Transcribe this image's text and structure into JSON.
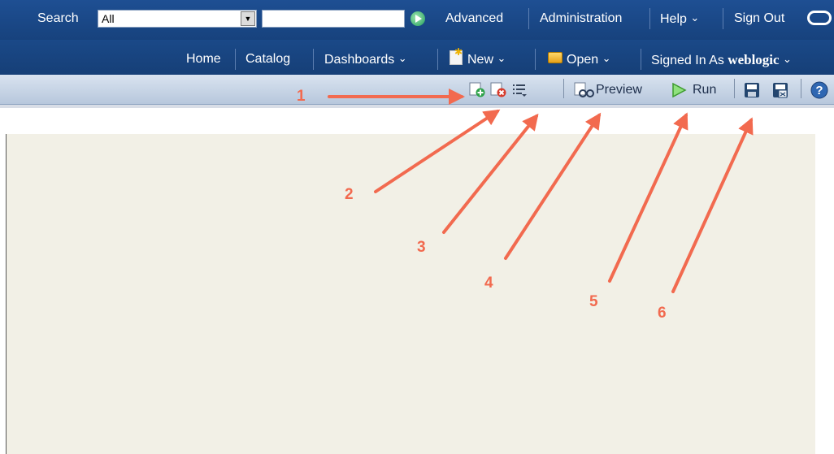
{
  "header": {
    "search_label": "Search",
    "search_scope_value": "All",
    "search_input_value": "",
    "advanced": "Advanced",
    "administration": "Administration",
    "help": "Help",
    "sign_out": "Sign Out",
    "chevron": "⌄"
  },
  "nav": {
    "home": "Home",
    "catalog": "Catalog",
    "dashboards": "Dashboards",
    "new": "New",
    "open": "Open",
    "signed_in_as": "Signed In As",
    "user": "weblogic"
  },
  "toolbar": {
    "preview": "Preview",
    "run": "Run"
  },
  "callouts": [
    "1",
    "2",
    "3",
    "4",
    "5",
    "6"
  ],
  "colors": {
    "header_blue": "#1c4a88",
    "toolbar_light": "#c8d6e7",
    "canvas_bg": "#f2f0e6",
    "annotation_red": "#f26a4f"
  }
}
